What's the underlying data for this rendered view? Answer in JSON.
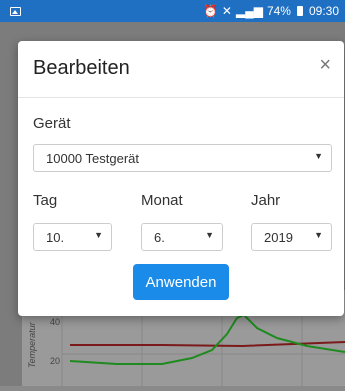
{
  "status_bar": {
    "battery": "74%",
    "time": "09:30",
    "icons": [
      "image-icon",
      "alarm-icon",
      "mute-icon",
      "signal-icon",
      "battery-icon"
    ]
  },
  "dialog": {
    "title": "Bearbeiten",
    "close": "×",
    "device": {
      "label": "Gerät",
      "value": "10000 Testgerät"
    },
    "day": {
      "label": "Tag",
      "value": "10."
    },
    "month": {
      "label": "Monat",
      "value": "6."
    },
    "year": {
      "label": "Jahr",
      "value": "2019"
    },
    "apply_label": "Anwenden"
  },
  "background": {
    "chart": {
      "ylabel": "Temperatur",
      "ticks": [
        "40",
        "20"
      ],
      "colors": {
        "red_series": "#7a1a1a",
        "green_series": "#1f8a1f"
      }
    }
  },
  "colors": {
    "status_bar": "#1f6fc3",
    "accent": "#1a8be8"
  }
}
